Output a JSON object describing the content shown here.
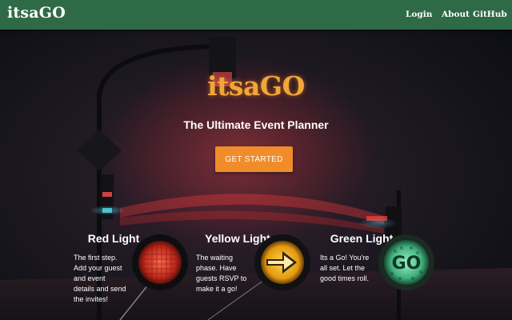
{
  "navbar": {
    "brand": "itsaGO",
    "links": [
      "Login",
      "About",
      "GitHub"
    ]
  },
  "hero": {
    "title": "itsaGO",
    "subtitle": "The Ultimate Event Planner",
    "cta_label": "GET STARTED"
  },
  "features": [
    {
      "title": "Red Light",
      "text": "The first step. Add your guest and event details and send the invites!",
      "icon": "red-traffic-light-icon"
    },
    {
      "title": "Yellow Light",
      "text": "The waiting phase. Have guests RSVP to make it a go!",
      "icon": "yellow-arrow-light-icon"
    },
    {
      "title": "Green Light",
      "text": "Its a Go! You're all set. Let the good times roll.",
      "icon": "green-go-light-icon",
      "icon_text": "GO"
    }
  ],
  "colors": {
    "navbar": "#2e6a45",
    "accent": "#f08c2a",
    "title": "#f2a63a"
  }
}
